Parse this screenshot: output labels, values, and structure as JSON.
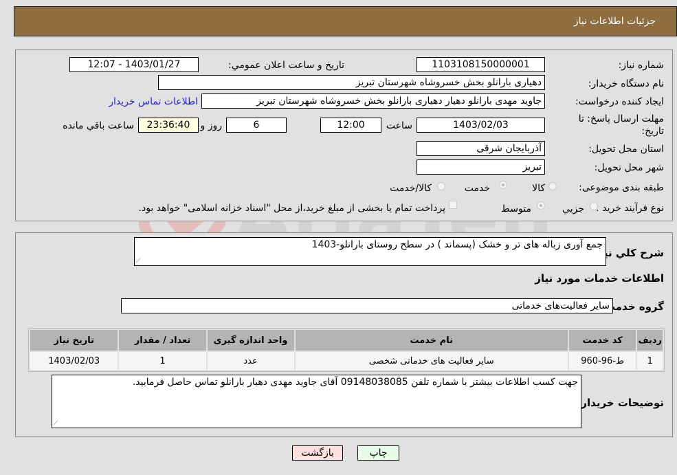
{
  "header": {
    "title": "جزئیات اطلاعات نیاز"
  },
  "details": {
    "need_number_label": "شماره نیاز:",
    "need_number": "1103108150000001",
    "announce_label": "تاريخ و ساعت اعلان عمومي:",
    "announce_value": "1403/01/27 - 12:07",
    "buyer_org_label": "نام دستگاه خریدار:",
    "buyer_org": "دهیاری بارانلو بخش خسروشاه شهرستان تبریز",
    "creator_label": "ایجاد کننده درخواست:",
    "creator": "جاوید مهدی بارانلو دهیار دهیاری بارانلو بخش خسروشاه شهرستان تبریز",
    "contact_link": "اطلاعات تماس خریدار",
    "deadline_label_1": "مهلت ارسال پاسخ: تا",
    "deadline_label_2": "تاریخ:",
    "deadline_date": "1403/02/03",
    "time_label": "ساعت",
    "deadline_time": "12:00",
    "days_value": "6",
    "days_label": "روز و",
    "remaining_time": "23:36:40",
    "remaining_label": "ساعت باقي مانده",
    "province_label": "استان محل تحویل:",
    "province": "آذربایجان شرقی",
    "city_label": "شهر محل تحویل:",
    "city": "تبریز",
    "category_label": "طبقه بندی موضوعی:",
    "category_options": [
      {
        "label": "کالا",
        "checked": false
      },
      {
        "label": "خدمت",
        "checked": true
      },
      {
        "label": "کالا/خدمت",
        "checked": false
      }
    ],
    "process_label": "نوع فرآیند خرید :",
    "process_options": [
      {
        "label": "جزيي",
        "checked": false
      },
      {
        "label": "متوسط",
        "checked": true
      }
    ],
    "treasury_note": "پرداخت تمام یا بخشی از مبلغ خرید،از محل \"اسناد خزانه اسلامی\" خواهد بود."
  },
  "need": {
    "description_label": "شرح كلي نياز:",
    "description": "جمع آوری زباله های تر و خشک (پسماند ) در سطح روستای بارانلو-1403",
    "services_heading": "اطلاعات خدمات مورد نياز",
    "service_group_label": "گروه خدمت:",
    "service_group": "سایر فعالیت‌های خدماتی"
  },
  "table": {
    "headers": [
      "رديف",
      "کد خدمت",
      "نام خدمت",
      "واحد اندازه گیری",
      "تعداد / مقدار",
      "تاریخ نیاز"
    ],
    "rows": [
      [
        "1",
        "ط-96-960",
        "سایر فعالیت های خدماتی شخصی",
        "عدد",
        "1",
        "1403/02/03"
      ]
    ]
  },
  "buyer_notes": {
    "label": "توضيحات خريدار:",
    "text": "جهت کسب اطلاعات بیشتر با شماره تلفن 09148038085 آقای جاوید مهدی دهیار بارانلو تماس حاصل فرمایید."
  },
  "buttons": {
    "print": "چاپ",
    "back": "بازگشت"
  },
  "watermark": {
    "text": "AriaTender.neT"
  },
  "colors": {
    "header_bg": "#8e6d41",
    "print_bg": "#e8fde8",
    "back_bg": "#fde0e0",
    "link": "#2222cc"
  }
}
